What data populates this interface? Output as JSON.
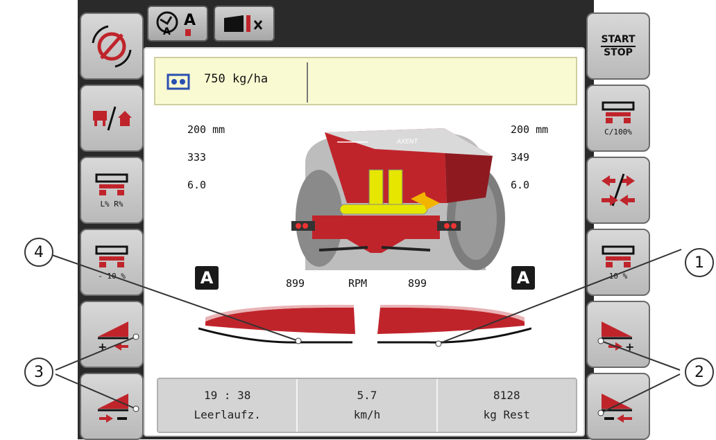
{
  "start_stop": {
    "line1": "START",
    "line2": "STOP"
  },
  "left_buttons": [
    {
      "icon": "rotor-off-icon",
      "sub": ""
    },
    {
      "icon": "spreader-home-icon",
      "sub": ""
    },
    {
      "icon": "spreader-lr-percent-icon",
      "sub": "L% R%"
    },
    {
      "icon": "spreader-minus-10-icon",
      "sub": "- 10 %"
    },
    {
      "icon": "boundary-left-increase-icon",
      "sub": ""
    },
    {
      "icon": "boundary-left-decrease-icon",
      "sub": ""
    }
  ],
  "right_buttons": [
    {
      "icon": "start-stop-icon",
      "sub": ""
    },
    {
      "icon": "spreader-c100-icon",
      "sub": "C/100%"
    },
    {
      "icon": "swap-arrows-icon",
      "sub": ""
    },
    {
      "icon": "spreader-plus-10-icon",
      "sub": "10 %"
    },
    {
      "icon": "boundary-right-increase-icon",
      "sub": ""
    },
    {
      "icon": "boundary-right-decrease-icon",
      "sub": ""
    }
  ],
  "rate": {
    "value": "750 kg/ha"
  },
  "left_values": [
    "200 mm",
    "333",
    "6.0"
  ],
  "right_values": [
    "200 mm",
    "349",
    "6.0"
  ],
  "auto_badge": "A",
  "rpm": {
    "left": "899",
    "label": "RPM",
    "right": "899"
  },
  "footer": [
    {
      "value": "19 : 38",
      "label": "Leerlaufz."
    },
    {
      "value": "5.7",
      "label": "km/h"
    },
    {
      "value": "8128",
      "label": "kg Rest"
    }
  ],
  "callouts": [
    "1",
    "2",
    "3",
    "4"
  ],
  "colors": {
    "accent": "#c0242b",
    "rate_bg": "#fafad2",
    "frame": "#2a2a2a"
  }
}
